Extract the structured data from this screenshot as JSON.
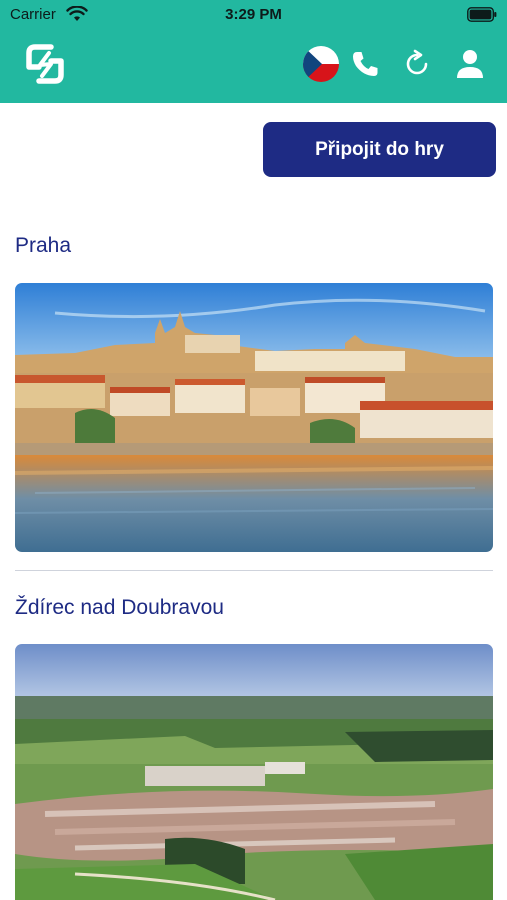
{
  "status_bar": {
    "carrier": "Carrier",
    "time": "3:29 PM"
  },
  "nav": {
    "background_color": "#22b8a0",
    "icons": [
      "app-logo-icon",
      "czech-flag-icon",
      "phone-icon",
      "refresh-icon",
      "user-icon"
    ]
  },
  "join_button": {
    "label": "Připojit do hry",
    "color": "#1e2b84"
  },
  "cities": [
    {
      "name": "Praha"
    },
    {
      "name": "Ždírec nad Doubravou"
    }
  ]
}
